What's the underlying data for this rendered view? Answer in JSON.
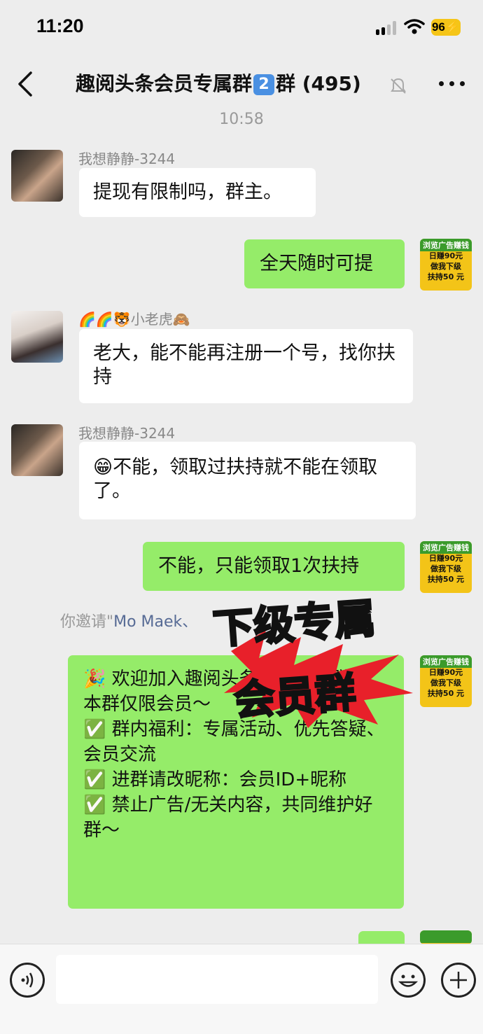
{
  "status_bar": {
    "time": "11:20",
    "battery": "96"
  },
  "nav": {
    "title_prefix": "趣阅头条会员专属群",
    "title_badge": "2",
    "title_suffix": "群 (495)"
  },
  "timestamp": "10:58",
  "messages": [
    {
      "sender": "我想静静-3244",
      "text": "提现有限制吗，群主。"
    },
    {
      "text": "全天随时可提"
    },
    {
      "sender": "🌈🌈🐯小老虎🙈",
      "text": "老大，能不能再注册一个号，找你扶持"
    },
    {
      "sender": "我想静静-3244",
      "text": "😁不能，领取过扶持就不能在领取了。"
    },
    {
      "text": "不能，只能领取1次扶持"
    },
    {
      "text": "🎉 欢迎加入趣阅头条会员专属群！\n本群仅限会员～\n✅ 群内福利：专属活动、优先答疑、会员交流\n✅ 进群请改昵称：会员ID+昵称\n✅ 禁止广告/无关内容，共同维护好群～"
    }
  ],
  "ad_avatar": {
    "line1": "浏览广告赚钱",
    "line2": "日赚90元",
    "line3": "做我下级",
    "line4": "扶持50 元"
  },
  "system": {
    "prefix": "你邀请\"",
    "name": "Mo Maek、"
  },
  "overlay": {
    "line1": "下级专属",
    "line2": "会员群"
  },
  "colors": {
    "accent_green": "#95ec69",
    "background": "#ededed",
    "link": "#576b95"
  }
}
